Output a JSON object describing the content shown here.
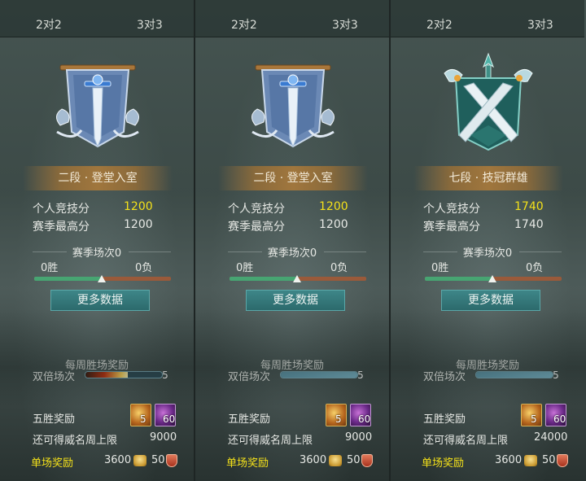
{
  "panels": [
    {
      "tabs": {
        "left": "2对2",
        "right": "3对3"
      },
      "emblem": "banner-sword-icon",
      "rank": "二段 · 登堂入室",
      "stats": {
        "score_label": "个人竞技分",
        "score": "1200",
        "best_label": "赛季最高分",
        "best": "1200"
      },
      "season": {
        "title": "赛季场次0",
        "wins": "0胜",
        "losses": "0负",
        "win_ratio": 0.5
      },
      "more_button": "更多数据",
      "weekly": {
        "title": "每周胜场奖励",
        "double_label": "双倍场次",
        "double_cap": "5",
        "bar_style": "fire",
        "double_fill": 0.55
      },
      "five_win": {
        "label": "五胜奖励",
        "item1_qty": "5",
        "item2_qty": "60"
      },
      "cap": {
        "label": "还可得威名周上限",
        "value": "9000"
      },
      "single": {
        "label": "单场奖励",
        "coins": "3600",
        "honor": "50"
      }
    },
    {
      "tabs": {
        "left": "2对2",
        "right": "3对3"
      },
      "emblem": "banner-sword-icon",
      "rank": "二段 · 登堂入室",
      "stats": {
        "score_label": "个人竞技分",
        "score": "1200",
        "best_label": "赛季最高分",
        "best": "1200"
      },
      "season": {
        "title": "赛季场次0",
        "wins": "0胜",
        "losses": "0负",
        "win_ratio": 0.5
      },
      "more_button": "更多数据",
      "weekly": {
        "title": "每周胜场奖励",
        "double_label": "双倍场次",
        "double_cap": "5",
        "bar_style": "blue",
        "double_fill": 1.0
      },
      "five_win": {
        "label": "五胜奖励",
        "item1_qty": "5",
        "item2_qty": "60"
      },
      "cap": {
        "label": "还可得威名周上限",
        "value": "9000"
      },
      "single": {
        "label": "单场奖励",
        "coins": "3600",
        "honor": "50"
      }
    },
    {
      "tabs": {
        "left": "2对2",
        "right": "3对3"
      },
      "emblem": "crossed-swords-crest-icon",
      "rank": "七段 · 技冠群雄",
      "stats": {
        "score_label": "个人竞技分",
        "score": "1740",
        "best_label": "赛季最高分",
        "best": "1740"
      },
      "season": {
        "title": "赛季场次0",
        "wins": "0胜",
        "losses": "0负",
        "win_ratio": 0.5
      },
      "more_button": "更多数据",
      "weekly": {
        "title": "每周胜场奖励",
        "double_label": "双倍场次",
        "double_cap": "5",
        "bar_style": "blue",
        "double_fill": 1.0
      },
      "five_win": {
        "label": "五胜奖励",
        "item1_qty": "5",
        "item2_qty": "60"
      },
      "cap": {
        "label": "还可得威名周上限",
        "value": "24000"
      },
      "single": {
        "label": "单场奖励",
        "coins": "3600",
        "honor": "50"
      }
    }
  ],
  "colors": {
    "gold_text": "#f4e11a",
    "button_teal": "#2c6a6c",
    "win_green": "#47a572",
    "loss_red": "#9a5a3a"
  }
}
